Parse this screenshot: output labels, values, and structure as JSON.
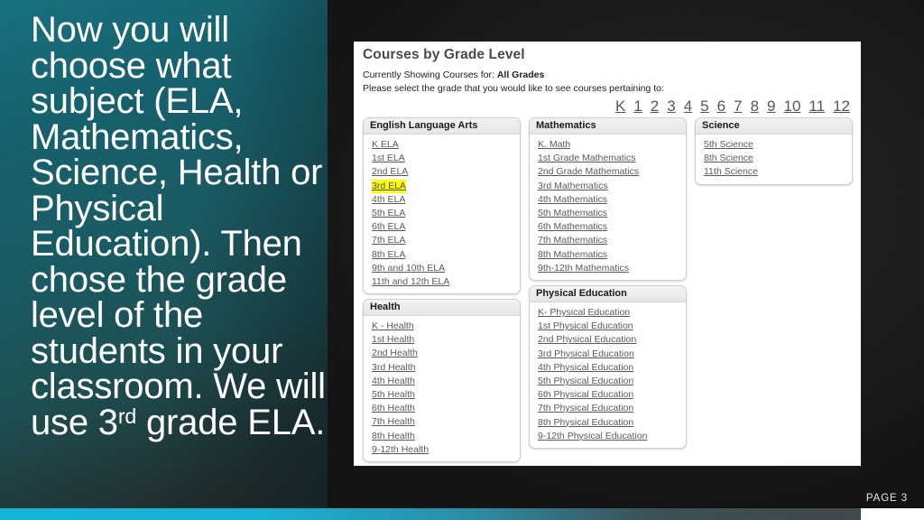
{
  "slide": {
    "caption": "Now you will choose what subject (ELA, Mathematics, Science, Health or Physical Education). Then chose the grade level of the students in your classroom. We will use 3",
    "caption_sup": "rd",
    "caption_tail": " grade ELA.",
    "page_label": "PAGE 3",
    "accent_color": "#16b4d8",
    "panel_bg": "#ffffff",
    "highlight_color": "#ffff00"
  },
  "app": {
    "title": "Courses by Grade Level",
    "showing_prefix": "Currently Showing Courses for:",
    "showing_value": "All Grades",
    "instruction": "Please select the grade that you would like to see courses pertaining to:",
    "grades": [
      "K",
      "1",
      "2",
      "3",
      "4",
      "5",
      "6",
      "7",
      "8",
      "9",
      "10",
      "11",
      "12"
    ],
    "cards": [
      {
        "id": "ela",
        "title": "English Language Arts",
        "items": [
          {
            "label": "K ELA",
            "highlighted": false
          },
          {
            "label": "1st ELA",
            "highlighted": false
          },
          {
            "label": "2nd ELA",
            "highlighted": false
          },
          {
            "label": "3rd ELA",
            "highlighted": true
          },
          {
            "label": "4th ELA",
            "highlighted": false
          },
          {
            "label": "5th ELA",
            "highlighted": false
          },
          {
            "label": "6th ELA",
            "highlighted": false
          },
          {
            "label": "7th ELA",
            "highlighted": false
          },
          {
            "label": "8th ELA",
            "highlighted": false
          },
          {
            "label": "9th and 10th ELA",
            "highlighted": false
          },
          {
            "label": "11th and 12th ELA",
            "highlighted": false
          }
        ]
      },
      {
        "id": "math",
        "title": "Mathematics",
        "items": [
          {
            "label": "K. Math",
            "highlighted": false
          },
          {
            "label": "1st Grade Mathematics",
            "highlighted": false
          },
          {
            "label": "2nd Grade Mathematics",
            "highlighted": false
          },
          {
            "label": "3rd Mathematics",
            "highlighted": false
          },
          {
            "label": "4th Mathematics",
            "highlighted": false
          },
          {
            "label": "5th Mathematics",
            "highlighted": false
          },
          {
            "label": "6th Mathematics",
            "highlighted": false
          },
          {
            "label": "7th Mathematics",
            "highlighted": false
          },
          {
            "label": "8th Mathematics",
            "highlighted": false
          },
          {
            "label": "9th-12th Mathematics",
            "highlighted": false
          }
        ]
      },
      {
        "id": "sci",
        "title": "Science",
        "items": [
          {
            "label": "5th Science",
            "highlighted": false
          },
          {
            "label": "8th Science",
            "highlighted": false
          },
          {
            "label": "11th Science",
            "highlighted": false
          }
        ]
      },
      {
        "id": "health",
        "title": "Health",
        "items": [
          {
            "label": "K - Health",
            "highlighted": false
          },
          {
            "label": "1st Health",
            "highlighted": false
          },
          {
            "label": "2nd Health",
            "highlighted": false
          },
          {
            "label": "3rd Health",
            "highlighted": false
          },
          {
            "label": "4th Health",
            "highlighted": false
          },
          {
            "label": "5th Health",
            "highlighted": false
          },
          {
            "label": "6th Health",
            "highlighted": false
          },
          {
            "label": "7th Health",
            "highlighted": false
          },
          {
            "label": "8th Health",
            "highlighted": false
          },
          {
            "label": "9-12th Health",
            "highlighted": false
          }
        ]
      },
      {
        "id": "pe",
        "title": "Physical Education",
        "items": [
          {
            "label": "K- Physical Education",
            "highlighted": false
          },
          {
            "label": "1st Physical Education",
            "highlighted": false
          },
          {
            "label": "2nd Physical Education",
            "highlighted": false
          },
          {
            "label": "3rd Physical Education",
            "highlighted": false
          },
          {
            "label": "4th Physical Education",
            "highlighted": false
          },
          {
            "label": "5th Physical Education",
            "highlighted": false
          },
          {
            "label": "6th Physical Education",
            "highlighted": false
          },
          {
            "label": "7th Physical Education",
            "highlighted": false
          },
          {
            "label": "8th Physical Education",
            "highlighted": false
          },
          {
            "label": "9-12th Physical Education",
            "highlighted": false
          }
        ]
      }
    ]
  }
}
